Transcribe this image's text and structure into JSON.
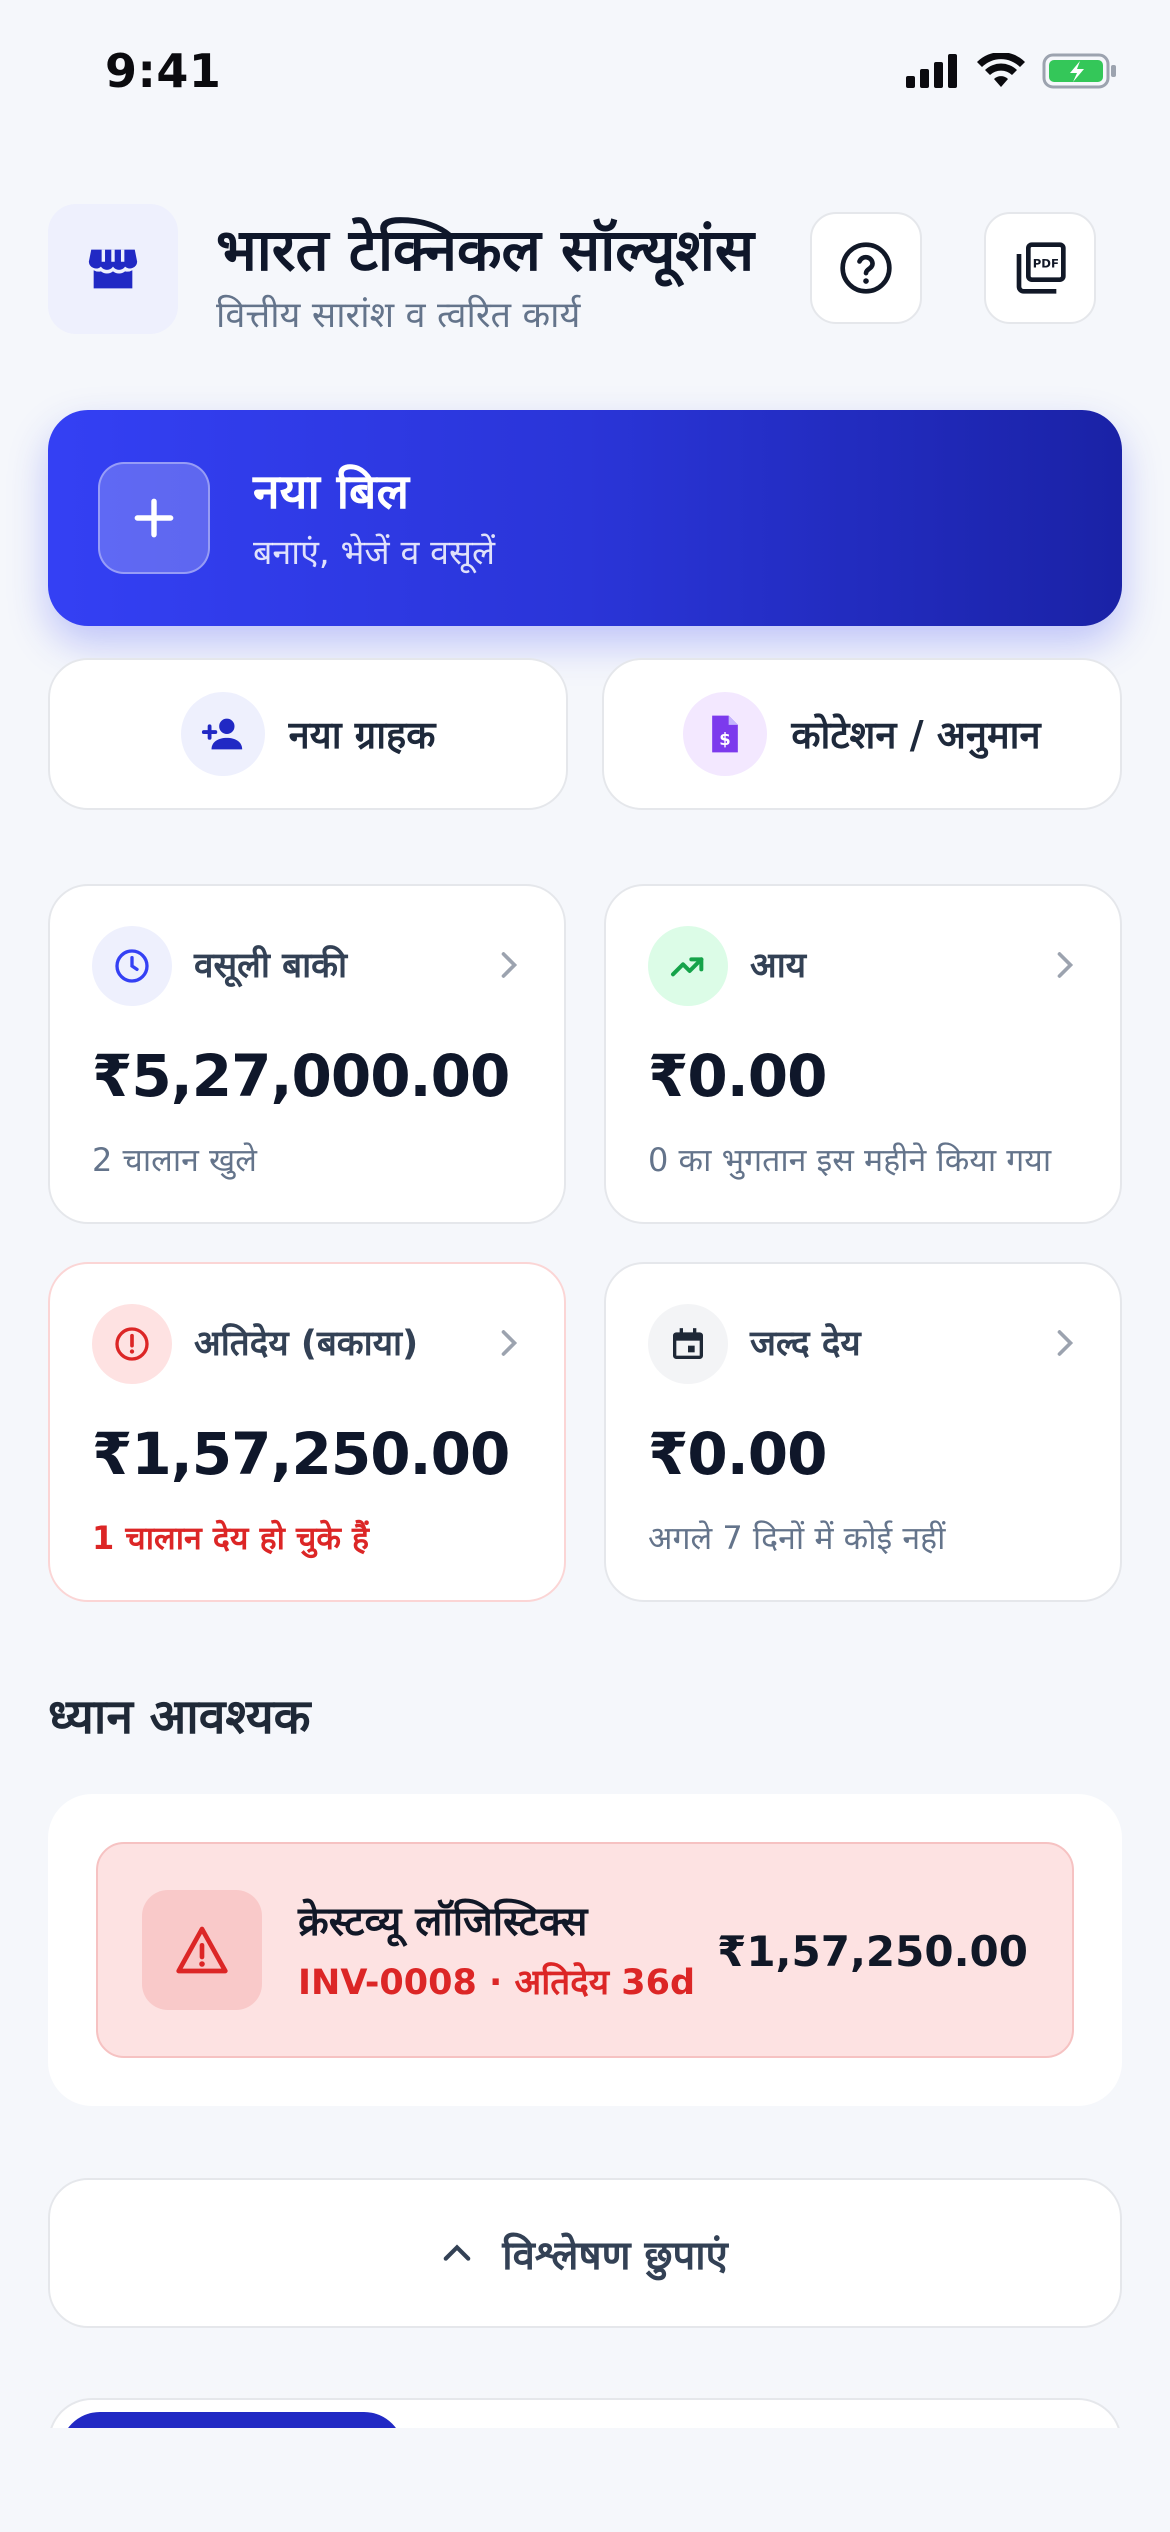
{
  "status_bar": {
    "time": "9:41"
  },
  "header": {
    "business_name": "भारत टेक्निकल सॉल्यूशंस",
    "subtitle": "वित्तीय सारांश व त्वरित कार्य"
  },
  "new_bill": {
    "title": "नया बिल",
    "subtitle": "बनाएं, भेजें व वसूलें"
  },
  "quick_actions": [
    {
      "label": "नया ग्राहक",
      "icon": "person-add-icon"
    },
    {
      "label": "कोटेशन / अनुमान",
      "icon": "quote-document-icon"
    }
  ],
  "stats": [
    {
      "title": "वसूली बाकी",
      "value": "₹5,27,000.00",
      "sub": "2 चालान खुले",
      "icon": "clock-icon",
      "accent": "#3440f4"
    },
    {
      "title": "आय",
      "value": "₹0.00",
      "sub": "0 का भुगतान इस महीने किया गया",
      "icon": "trending-up-icon",
      "accent": "#16a34a"
    },
    {
      "title": "अतिदेय (बकाया)",
      "value": "₹1,57,250.00",
      "sub": "1 चालान देय हो चुके हैं",
      "icon": "alert-circle-icon",
      "accent": "#dc2626"
    },
    {
      "title": "जल्द देय",
      "value": "₹0.00",
      "sub": "अगले 7 दिनों में कोई नहीं",
      "icon": "calendar-icon",
      "accent": "#1f2937"
    }
  ],
  "attention": {
    "title": "ध्यान आवश्यक",
    "items": [
      {
        "customer": "क्रेस्टव्यू लॉजिस्टिक्स",
        "meta": "INV-0008 · अतिदेय 36d",
        "amount": "₹1,57,250.00",
        "icon": "warning-triangle-icon"
      }
    ]
  },
  "analytics_toggle": {
    "label": "विश्लेषण छुपाएं",
    "icon": "chevron-up-icon"
  },
  "colors": {
    "primary": "#3440f4",
    "danger": "#dc2626",
    "success": "#16a34a",
    "background": "#f5f7fb"
  }
}
